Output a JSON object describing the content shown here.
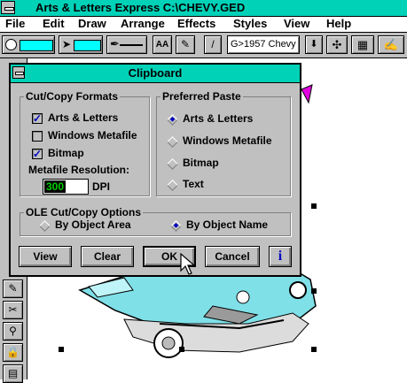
{
  "window": {
    "title": "Arts & Letters Express  C:\\CHEVY.GED"
  },
  "menu": [
    "File",
    "Edit",
    "Draw",
    "Arrange",
    "Effects",
    "Styles",
    "View",
    "Help"
  ],
  "toolbar": {
    "style_select": "G>1957 Chevy",
    "aa_label": "AA"
  },
  "colors": {
    "fill": "#00ffff",
    "titlebar": "#00d2b8",
    "dialog_bg": "#c0c0c0",
    "resolution_text": "#00cc00"
  },
  "dialog": {
    "title": "Clipboard",
    "formats": {
      "legend": "Cut/Copy Formats",
      "items": [
        {
          "label": "Arts & Letters",
          "checked": true,
          "check": "✓"
        },
        {
          "label": "Windows Metafile",
          "checked": false,
          "check": ""
        },
        {
          "label": "Bitmap",
          "checked": true,
          "check": "✓"
        }
      ],
      "resolution_label": "Metafile Resolution:",
      "resolution_value": "300",
      "resolution_unit": "DPI"
    },
    "paste": {
      "legend": "Preferred Paste",
      "options": [
        "Arts & Letters",
        "Windows Metafile",
        "Bitmap",
        "Text"
      ],
      "selected": "Arts & Letters"
    },
    "ole": {
      "legend": "OLE Cut/Copy Options",
      "options": [
        "By Object Area",
        "By Object Name"
      ],
      "selected": "By Object Name"
    },
    "buttons": {
      "view": "View",
      "clear": "Clear",
      "ok": "OK",
      "cancel": "Cancel",
      "info": "i"
    }
  }
}
